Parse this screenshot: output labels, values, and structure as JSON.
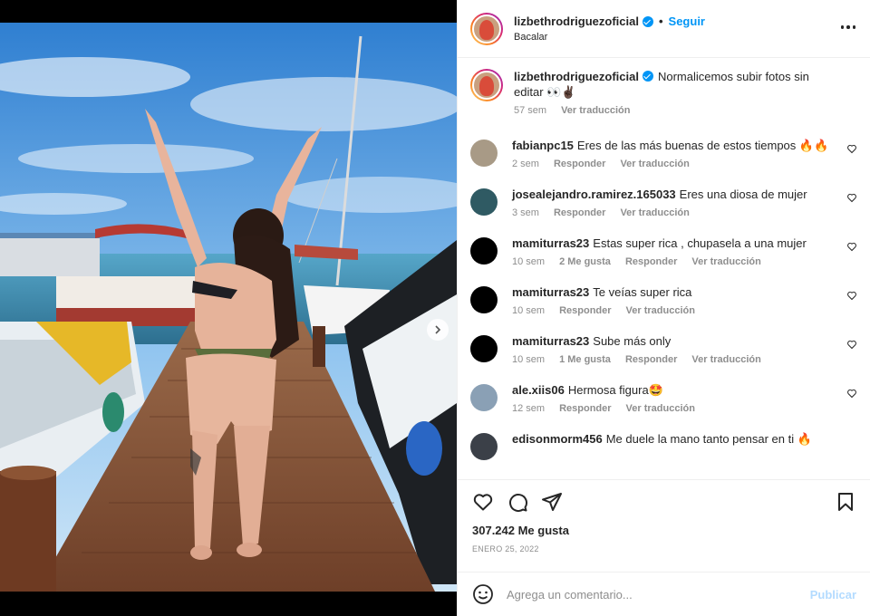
{
  "header": {
    "username": "lizbethrodriguezoficial",
    "separator": "•",
    "follow_label": "Seguir",
    "location": "Bacalar"
  },
  "caption": {
    "username": "lizbethrodriguezoficial",
    "text": "Normalicemos subir fotos sin editar 👀✌🏿",
    "time": "57 sem",
    "translate": "Ver traducción"
  },
  "comments": [
    {
      "username": "fabianpc15",
      "text": "Eres de las más buenas de estos tiempos 🔥🔥",
      "time": "2 sem",
      "likes": "",
      "reply": "Responder",
      "translate": "Ver traducción",
      "avatar_color": "#a89a86"
    },
    {
      "username": "josealejandro.ramirez.165033",
      "text": "Eres una diosa de mujer",
      "time": "3 sem",
      "likes": "",
      "reply": "Responder",
      "translate": "Ver traducción",
      "avatar_color": "#2f5a63"
    },
    {
      "username": "mamiturras23",
      "text": "Estas super rica , chupasela a una mujer",
      "time": "10 sem",
      "likes": "2 Me gusta",
      "reply": "Responder",
      "translate": "Ver traducción",
      "avatar_color": "#000000"
    },
    {
      "username": "mamiturras23",
      "text": "Te veías super rica",
      "time": "10 sem",
      "likes": "",
      "reply": "Responder",
      "translate": "Ver traducción",
      "avatar_color": "#000000"
    },
    {
      "username": "mamiturras23",
      "text": "Sube más only",
      "time": "10 sem",
      "likes": "1 Me gusta",
      "reply": "Responder",
      "translate": "Ver traducción",
      "avatar_color": "#000000"
    },
    {
      "username": "ale.xiis06",
      "text": "Hermosa figura🤩",
      "time": "12 sem",
      "likes": "",
      "reply": "Responder",
      "translate": "Ver traducción",
      "avatar_color": "#8aa0b5"
    },
    {
      "username": "edisonmorm456",
      "text": "Me duele la mano tanto pensar en ti 🔥",
      "time": "",
      "likes": "",
      "reply": "",
      "translate": "",
      "avatar_color": "#3b4048"
    }
  ],
  "post": {
    "likes": "307.242 Me gusta",
    "date": "ENERO 25, 2022"
  },
  "composer": {
    "placeholder": "Agrega un comentario...",
    "publish_label": "Publicar"
  },
  "colors": {
    "accent": "#0095f6",
    "text": "#262626",
    "muted": "#8e8e8e",
    "publish_disabled": "#b3dbff"
  }
}
